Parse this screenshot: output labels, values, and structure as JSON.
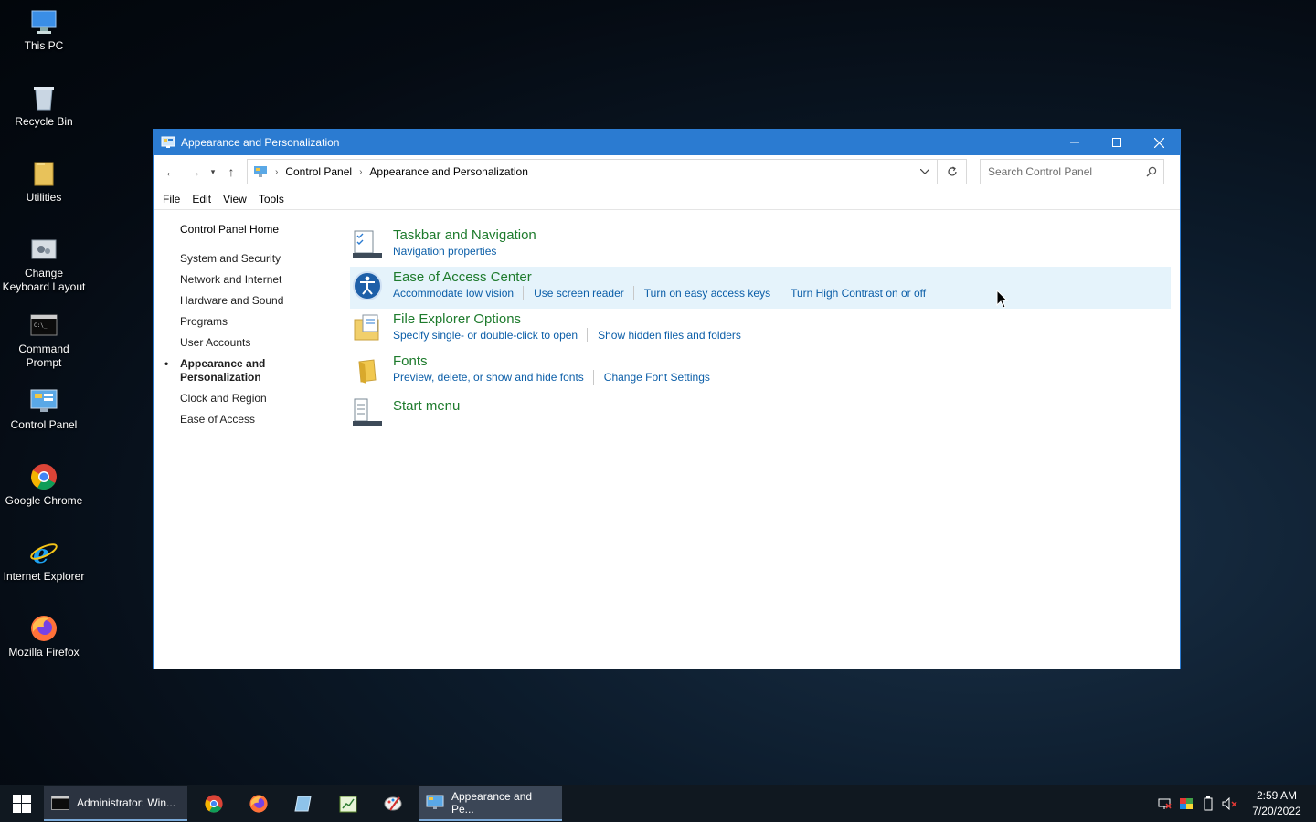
{
  "desktop": {
    "icons": [
      {
        "label": "This PC",
        "icon": "pc-icon"
      },
      {
        "label": "Recycle Bin",
        "icon": "recycle-bin-icon"
      },
      {
        "label": "Utilities",
        "icon": "folder-icon"
      },
      {
        "label": "Change Keyboard Layout",
        "icon": "keyboard-settings-icon"
      },
      {
        "label": "Command Prompt",
        "icon": "cmd-icon"
      },
      {
        "label": "Control Panel",
        "icon": "control-panel-icon"
      },
      {
        "label": "Google Chrome",
        "icon": "chrome-icon"
      },
      {
        "label": "Internet Explorer",
        "icon": "ie-icon"
      },
      {
        "label": "Mozilla Firefox",
        "icon": "firefox-icon"
      }
    ]
  },
  "window": {
    "title": "Appearance and Personalization",
    "address": {
      "crumbs": [
        "Control Panel",
        "Appearance and Personalization"
      ]
    },
    "search": {
      "placeholder": "Search Control Panel"
    },
    "menu": [
      "File",
      "Edit",
      "View",
      "Tools"
    ],
    "sidebar": {
      "home": "Control Panel Home",
      "items": [
        "System and Security",
        "Network and Internet",
        "Hardware and Sound",
        "Programs",
        "User Accounts",
        "Appearance and Personalization",
        "Clock and Region",
        "Ease of Access"
      ],
      "active_index": 5
    },
    "categories": [
      {
        "title": "Taskbar and Navigation",
        "links": [
          "Navigation properties"
        ]
      },
      {
        "title": "Ease of Access Center",
        "links": [
          "Accommodate low vision",
          "Use screen reader",
          "Turn on easy access keys",
          "Turn High Contrast on or off"
        ]
      },
      {
        "title": "File Explorer Options",
        "links": [
          "Specify single- or double-click to open",
          "Show hidden files and folders"
        ]
      },
      {
        "title": "Fonts",
        "links": [
          "Preview, delete, or show and hide fonts",
          "Change Font Settings"
        ]
      },
      {
        "title": "Start menu",
        "links": []
      }
    ]
  },
  "taskbar": {
    "items": [
      {
        "label": "Administrator: Win...",
        "icon": "cmd-icon"
      },
      {
        "label": "Appearance and Pe...",
        "icon": "control-panel-icon"
      }
    ],
    "pinned": [
      "chrome-icon",
      "firefox-icon",
      "notepad-icon",
      "spreadsheet-icon",
      "paint-icon"
    ],
    "clock": {
      "time": "2:59 AM",
      "date": "7/20/2022"
    }
  },
  "colors": {
    "titlebar": "#2b7bd1",
    "category_title": "#1e7b2d",
    "link": "#0b5ea8",
    "hover_row": "#e5f3fb"
  }
}
